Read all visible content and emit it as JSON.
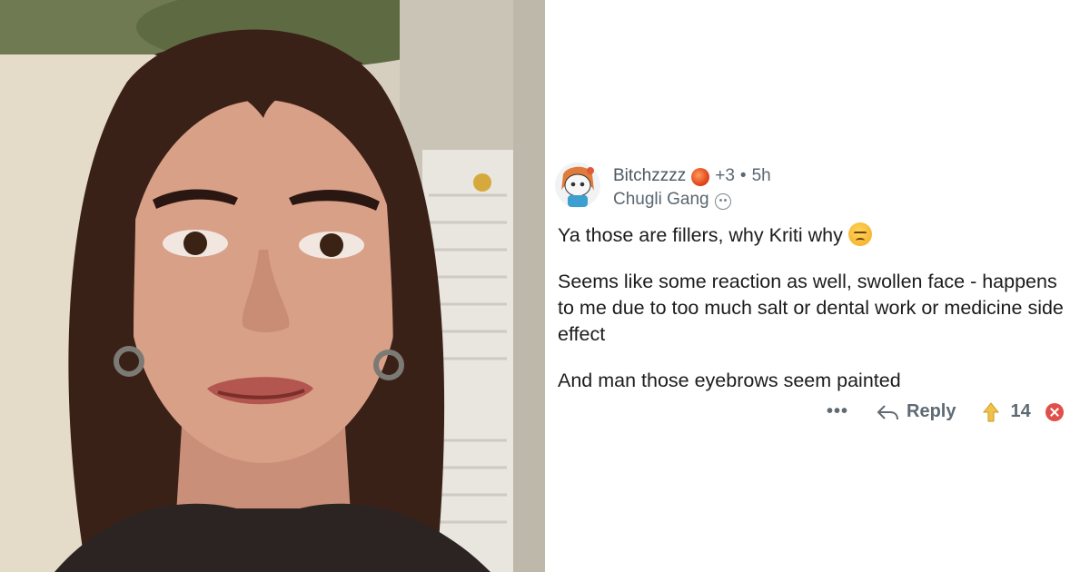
{
  "comment": {
    "username": "Bitchzzzz",
    "award_extra": "+3",
    "separator": "•",
    "time_ago": "5h",
    "flair": "Chugli Gang",
    "paragraphs": [
      "Ya those are fillers, why Kriti why",
      "Seems like some reaction as well, swollen face - happens to me due to too much salt or dental work or medicine side effect",
      "And man those eyebrows seem painted"
    ],
    "actions": {
      "more": "•••",
      "reply": "Reply",
      "vote_count": "14"
    }
  },
  "icons": {
    "avatar": "reddit-avatar-icon",
    "award": "award-icon",
    "flair": "snoo-icon",
    "emoji": "unamused-face-emoji",
    "reply": "reply-arrow-icon",
    "upvote": "upvote-icon",
    "downvote": "downvote-icon"
  },
  "colors": {
    "meta_text": "#5a6670",
    "body_text": "#1c1c1c",
    "upvote": "#d9a92f",
    "downvote": "#e0504a"
  }
}
